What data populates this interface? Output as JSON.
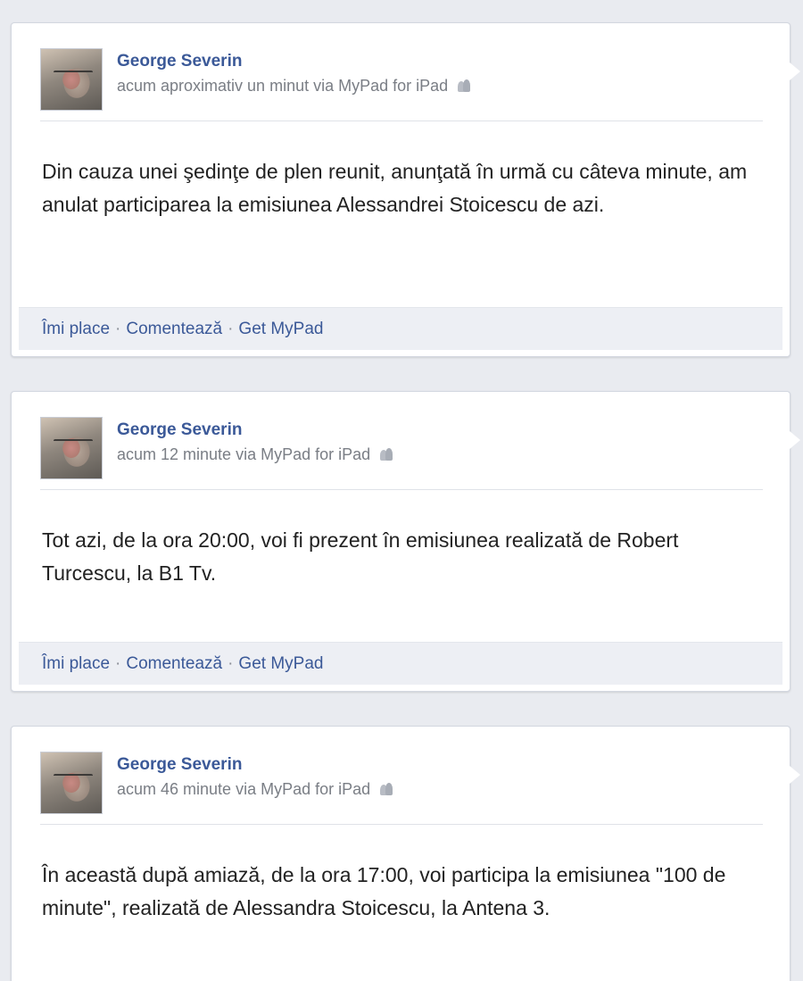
{
  "posts": [
    {
      "author": "George Severin",
      "meta": "acum aproximativ un minut via MyPad for iPad",
      "body": "Din cauza unei şedinţe de plen reunit, anunţată în urmă cu câteva minute, am anulat participarea la emisiunea Alessandrei Stoicescu de azi.",
      "actions": {
        "like": "Îmi place",
        "comment": "Comentează",
        "get_app": "Get MyPad"
      }
    },
    {
      "author": "George Severin",
      "meta": "acum 12 minute via MyPad for iPad",
      "body": "Tot azi, de la ora 20:00, voi fi prezent în emisiunea realizată de Robert Turcescu, la B1 Tv.",
      "actions": {
        "like": "Îmi place",
        "comment": "Comentează",
        "get_app": "Get MyPad"
      }
    },
    {
      "author": "George Severin",
      "meta": "acum 46 minute via MyPad for iPad",
      "body": "În această după amiază, de la ora 17:00, voi participa la emisiunea \"100 de minute\", realizată de Alessandra Stoicescu, la Antena 3."
    }
  ],
  "separator": "·",
  "icons": {
    "avatar": "profile-photo",
    "audience": "friends-icon"
  },
  "colors": {
    "link": "#3b5998",
    "meta": "#7a7e85",
    "background": "#e9ebf0"
  }
}
